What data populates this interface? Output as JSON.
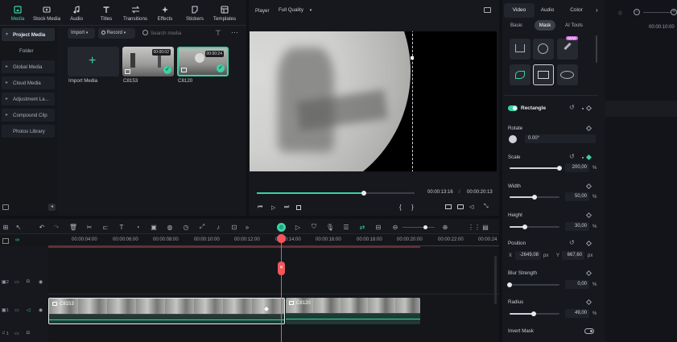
{
  "topnav": [
    {
      "label": "Media",
      "icon": "media-icon"
    },
    {
      "label": "Stock Media",
      "icon": "stock-media-icon"
    },
    {
      "label": "Audio",
      "icon": "music-note-icon"
    },
    {
      "label": "Titles",
      "icon": "titles-icon"
    },
    {
      "label": "Transitions",
      "icon": "transitions-icon"
    },
    {
      "label": "Effects",
      "icon": "effects-icon"
    },
    {
      "label": "Stickers",
      "icon": "stickers-icon"
    },
    {
      "label": "Templates",
      "icon": "templates-icon"
    }
  ],
  "sidebar": {
    "items": [
      {
        "label": "Project Media",
        "active": true
      },
      {
        "label": "Folder"
      },
      {
        "label": "Global Media"
      },
      {
        "label": "Cloud Media"
      },
      {
        "label": "Adjustment La..."
      },
      {
        "label": "Compound Clip"
      },
      {
        "label": "Photos Library"
      }
    ]
  },
  "media": {
    "import_btn": "Import",
    "record_btn": "Record",
    "search_placeholder": "Search media",
    "import_media_label": "Import Media",
    "clips": [
      {
        "name": "C8153",
        "duration": "00:00:02"
      },
      {
        "name": "C8120",
        "duration": "00:00:24"
      }
    ]
  },
  "player": {
    "label": "Player",
    "quality": "Full Quality",
    "current_time": "00:00:13:16",
    "total_time": "00:00:20:13",
    "progress": 0.68
  },
  "timeline": {
    "ticks": [
      "00:00:04:00",
      "00:00:06:00",
      "00:00:08:00",
      "00:00:10:00",
      "00:00:12:00",
      "00:00:14:00",
      "00:00:16:00",
      "00:00:18:00",
      "00:00:20:00",
      "00:00:22:00",
      "00:00:24"
    ],
    "clip1": "C8153",
    "clip2": "C8120",
    "track2": "2",
    "track1": "1",
    "track_audio": "1"
  },
  "right_panel": {
    "tabs": [
      "Video",
      "Audio",
      "Color"
    ],
    "subtabs": [
      "Basic",
      "Mask",
      "AI Tools"
    ],
    "new_badge": "NEW",
    "mask_name": "Rectangle",
    "rotate": {
      "label": "Rotate",
      "value": "0.00°"
    },
    "scale": {
      "label": "Scale",
      "value": "200,00",
      "unit": "%",
      "fraction": 1.0
    },
    "width": {
      "label": "Width",
      "value": "50,00",
      "unit": "%",
      "fraction": 0.5
    },
    "height": {
      "label": "Height",
      "value": "30,00",
      "unit": "%",
      "fraction": 0.3
    },
    "position": {
      "label": "Position",
      "x_label": "X",
      "x": "-2649,08",
      "y_label": "Y",
      "y": "667,60",
      "unit": "px"
    },
    "blur": {
      "label": "Blur Strength",
      "value": "0,00",
      "unit": "%",
      "fraction": 0.0
    },
    "radius": {
      "label": "Radius",
      "value": "49,00",
      "unit": "%",
      "fraction": 0.49
    },
    "invert_label": "Invert Mask"
  },
  "far_right": {
    "time": "00:00:10:00"
  }
}
